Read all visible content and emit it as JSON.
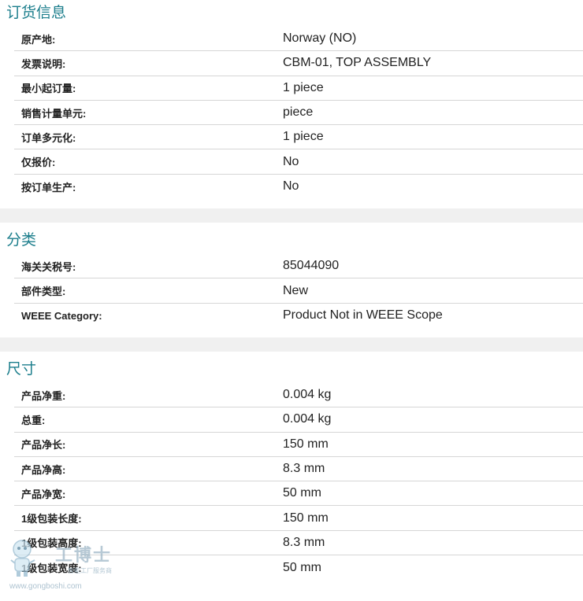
{
  "sections": [
    {
      "title": "订货信息",
      "rows": [
        {
          "label": "原产地:",
          "value": "Norway (NO)"
        },
        {
          "label": "发票说明:",
          "value": "CBM-01, TOP ASSEMBLY"
        },
        {
          "label": "最小起订量:",
          "value": "1 piece"
        },
        {
          "label": "销售计量单元:",
          "value": "piece"
        },
        {
          "label": "订单多元化:",
          "value": "1 piece"
        },
        {
          "label": "仅报价:",
          "value": "No"
        },
        {
          "label": "按订单生产:",
          "value": "No"
        }
      ]
    },
    {
      "title": "分类",
      "rows": [
        {
          "label": "海关关税号:",
          "value": "85044090"
        },
        {
          "label": "部件类型:",
          "value": "New"
        },
        {
          "label": "WEEE Category:",
          "value": "Product Not in WEEE Scope"
        }
      ]
    },
    {
      "title": "尺寸",
      "rows": [
        {
          "label": "产品净重:",
          "value": "0.004 kg"
        },
        {
          "label": "总重:",
          "value": "0.004 kg"
        },
        {
          "label": "产品净长:",
          "value": "150 mm"
        },
        {
          "label": "产品净高:",
          "value": "8.3 mm"
        },
        {
          "label": "产品净宽:",
          "value": "50 mm"
        },
        {
          "label": "1级包装长度:",
          "value": "150 mm"
        },
        {
          "label": "1级包装高度:",
          "value": "8.3 mm"
        },
        {
          "label": "1级包装宽度:",
          "value": "50 mm"
        }
      ]
    }
  ],
  "watermark": {
    "logo_text": "工博士",
    "subtitle": "智能工厂服务商",
    "url": "www.gongboshi.com"
  }
}
